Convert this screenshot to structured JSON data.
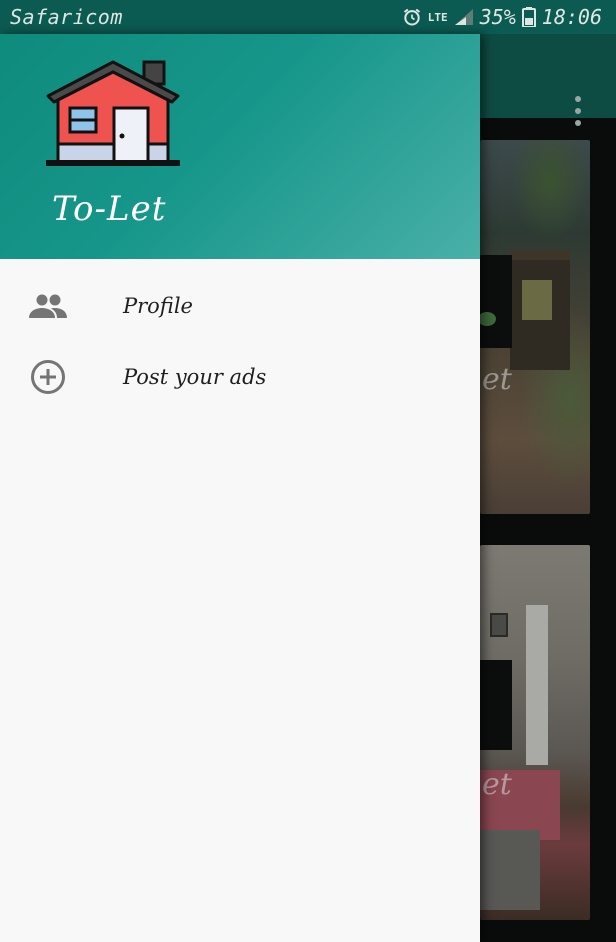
{
  "status_bar": {
    "carrier": "Safaricom",
    "network": "LTE",
    "battery": "35%",
    "time": "18:06"
  },
  "drawer": {
    "app_name": "To-Let",
    "header_colors": [
      "#0e8b7c",
      "#4ab0a8"
    ],
    "menu": [
      {
        "label": "Profile",
        "icon": "people-icon"
      },
      {
        "label": "Post your ads",
        "icon": "add-circle-icon"
      }
    ]
  },
  "background": {
    "card_watermark": "et"
  }
}
